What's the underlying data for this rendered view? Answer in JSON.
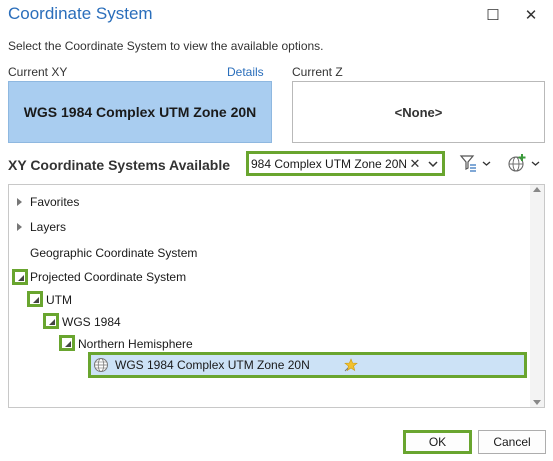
{
  "window": {
    "title": "Coordinate System",
    "maximize_glyph": "☐",
    "close_glyph": "✕"
  },
  "instructions": "Select the Coordinate System to view the available options.",
  "current_xy": {
    "label": "Current XY",
    "details_link": "Details",
    "value": "WGS 1984 Complex UTM Zone 20N"
  },
  "current_z": {
    "label": "Current Z",
    "value": "<None>"
  },
  "available": {
    "heading": "XY Coordinate Systems Available",
    "search_value": "984 Complex UTM Zone 20N",
    "clear_glyph": "✕",
    "dropdown_glyph": "⌄",
    "toolbar_icons": [
      "filter-icon",
      "add-globe-icon"
    ]
  },
  "tree": {
    "favorites": "Favorites",
    "layers": "Layers",
    "geographic": "Geographic Coordinate System",
    "projected": "Projected Coordinate System",
    "utm": "UTM",
    "wgs1984": "WGS 1984",
    "northern": "Northern Hemisphere",
    "selected": "WGS 1984 Complex UTM Zone 20N"
  },
  "buttons": {
    "ok": "OK",
    "cancel": "Cancel"
  },
  "colors": {
    "title": "#2a6ebb",
    "highlight_border": "#69a52f",
    "current_xy_fill": "#a9cdf0",
    "selected_row_fill": "#cce2f6"
  }
}
